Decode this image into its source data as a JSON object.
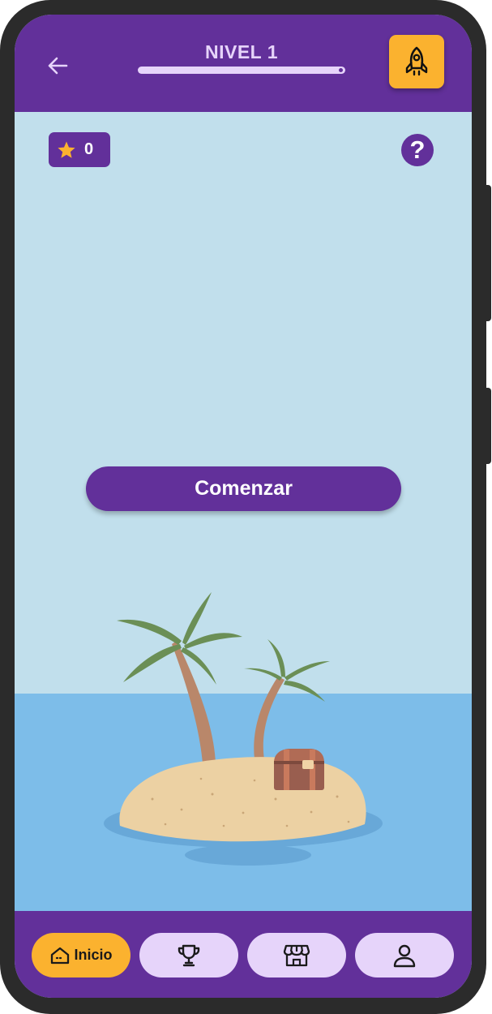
{
  "header": {
    "title": "NIVEL 1",
    "progress": 1.0
  },
  "status": {
    "stars": "0",
    "help": "?"
  },
  "main": {
    "start_label": "Comenzar"
  },
  "bottom_nav": {
    "items": [
      {
        "label": "Inicio",
        "icon": "home-icon",
        "active": true
      },
      {
        "label": "",
        "icon": "trophy-icon",
        "active": false
      },
      {
        "label": "",
        "icon": "store-icon",
        "active": false
      },
      {
        "label": "",
        "icon": "user-icon",
        "active": false
      }
    ]
  },
  "colors": {
    "primary": "#62309a",
    "accent": "#fbb22f",
    "nav_inactive": "#e6d4fa",
    "sky": "#c1dfec",
    "sea": "#7dbde9",
    "sand": "#ecd1a3",
    "palm_leaf": "#6b8f56",
    "palm_trunk": "#b9876a"
  }
}
